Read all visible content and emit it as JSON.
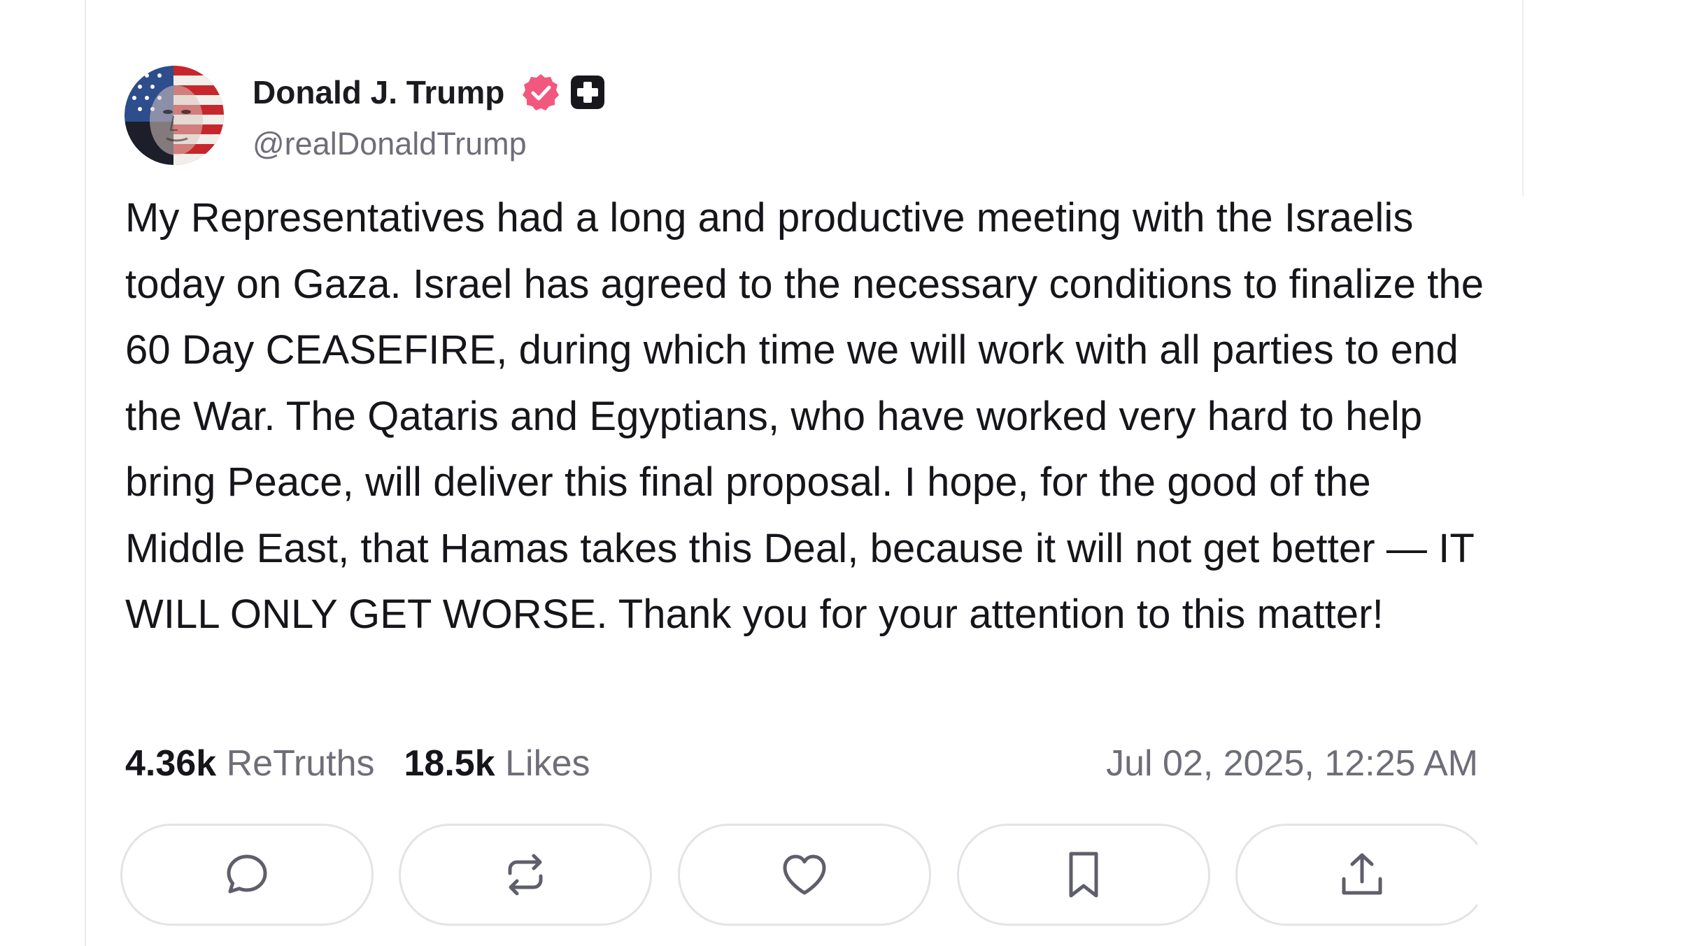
{
  "post": {
    "author": {
      "display_name": "Donald J. Trump",
      "handle": "@realDonaldTrump",
      "verified": true,
      "avatar_icon": "flag-portrait-avatar",
      "badge_icons": [
        "verified-badge-icon",
        "plus-badge-icon"
      ]
    },
    "body": "My Representatives had a long and productive meeting with the Israelis today on Gaza. Israel has agreed to the necessary conditions to finalize the 60 Day CEASEFIRE, during which time we will work with all parties to end the War. The Qataris and Egyptians, who have worked very hard to help bring Peace, will deliver this final proposal. I hope, for the good of the Middle East, that Hamas takes this Deal, because it will not get better — IT WILL ONLY GET WORSE. Thank you for your attention to this matter!",
    "stats": {
      "retruths_count": "4.36k",
      "retruths_label": "ReTruths",
      "likes_count": "18.5k",
      "likes_label": "Likes"
    },
    "timestamp": "Jul 02, 2025, 12:25 AM",
    "actions": [
      {
        "name": "reply",
        "icon": "reply-icon"
      },
      {
        "name": "retruth",
        "icon": "retruth-icon"
      },
      {
        "name": "like",
        "icon": "heart-icon"
      },
      {
        "name": "bookmark",
        "icon": "bookmark-icon"
      },
      {
        "name": "share",
        "icon": "share-icon"
      }
    ],
    "colors": {
      "verified_badge": "#f2587e",
      "text_primary": "#15151a",
      "text_secondary": "#6e6e78",
      "border": "#e3e3e8"
    }
  }
}
